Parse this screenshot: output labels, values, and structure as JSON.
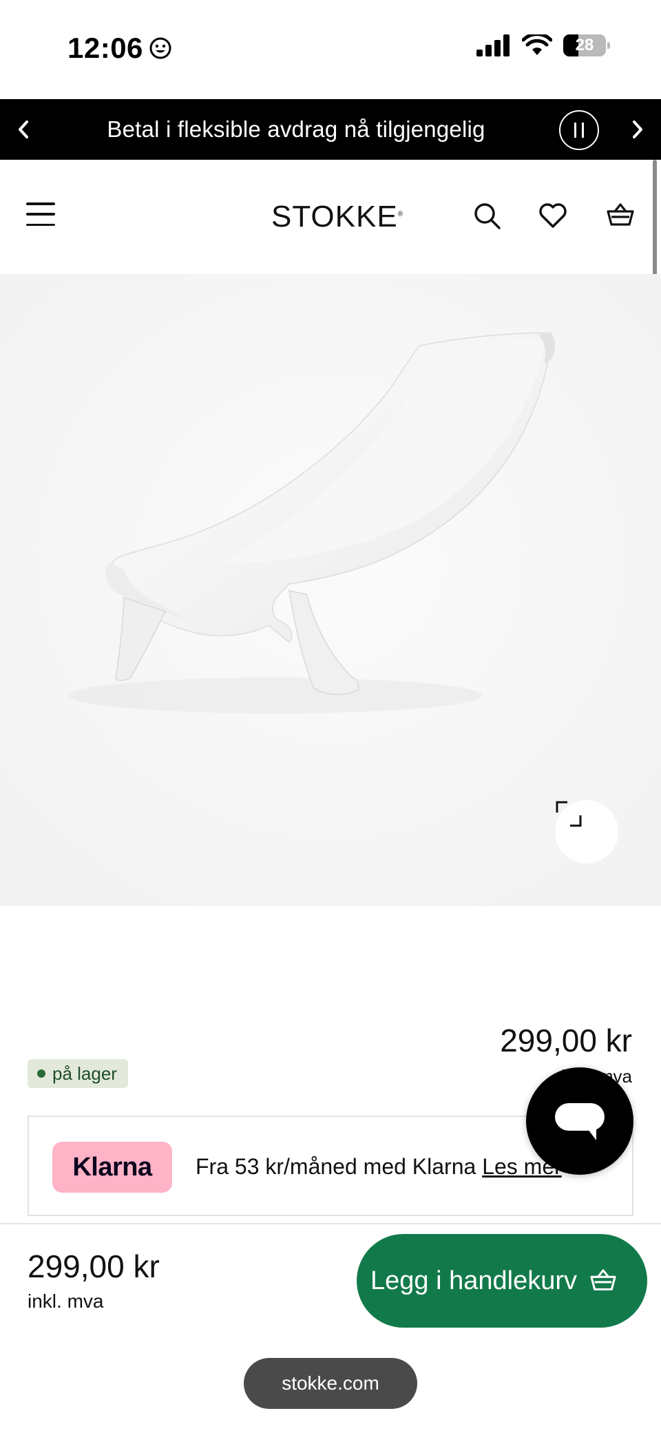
{
  "status_bar": {
    "time": "12:06",
    "battery": "28",
    "icons": [
      "smiley-icon",
      "signal-icon",
      "wifi-icon",
      "battery-icon"
    ]
  },
  "banner": {
    "text": "Betal i fleksible avdrag nå tilgjengelig",
    "icons": [
      "chevron-left-icon",
      "pause-icon",
      "chevron-right-icon"
    ]
  },
  "header": {
    "logo": "STOKKE",
    "logo_mark": "®",
    "icons": [
      "menu-icon",
      "search-icon",
      "heart-icon",
      "basket-icon"
    ]
  },
  "product": {
    "image_icon": "expand-icon",
    "price": "299,00 kr",
    "vat_label": "inkl. mva",
    "stock": "på lager"
  },
  "klarna": {
    "logo": "Klarna",
    "text": "Fra 53 kr/måned med Klarna ",
    "link": "Les mer"
  },
  "chat": {
    "icon": "chat-bubble-icon"
  },
  "bottom_bar": {
    "price": "299,00 kr",
    "vat_label": "inkl. mva",
    "add_to_cart": "Legg i handlekurv",
    "url": "stokke.com"
  },
  "colors": {
    "banner_bg": "#000000",
    "add_to_cart_bg": "#127a4a",
    "klarna_pink": "#ffb3c7",
    "stock_badge_bg": "#e3e9da",
    "stock_text": "#1f4d2a"
  }
}
